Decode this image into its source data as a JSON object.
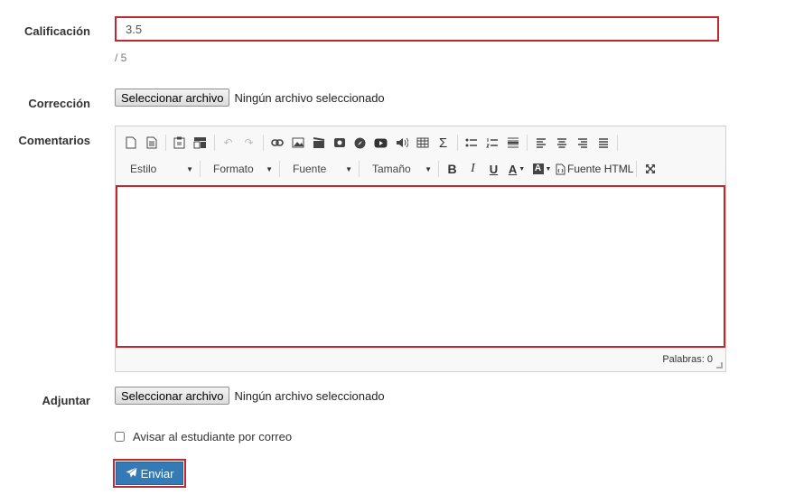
{
  "grade": {
    "label": "Calificación",
    "value": "3.5",
    "max_text": "/ 5"
  },
  "correction": {
    "label": "Corrección",
    "button": "Seleccionar archivo",
    "status": "Ningún archivo seleccionado"
  },
  "comments": {
    "label": "Comentarios",
    "toolbar": {
      "style": "Estilo",
      "format": "Formato",
      "font": "Fuente",
      "size": "Tamaño",
      "source": "Fuente HTML"
    },
    "word_count": "Palabras: 0"
  },
  "attach": {
    "label": "Adjuntar",
    "button": "Seleccionar archivo",
    "status": "Ningún archivo seleccionado"
  },
  "notify": {
    "label": "Avisar al estudiante por correo",
    "checked": false
  },
  "submit": {
    "label": "Enviar"
  },
  "colors": {
    "highlight": "#c1272d",
    "primary": "#337ab7"
  }
}
